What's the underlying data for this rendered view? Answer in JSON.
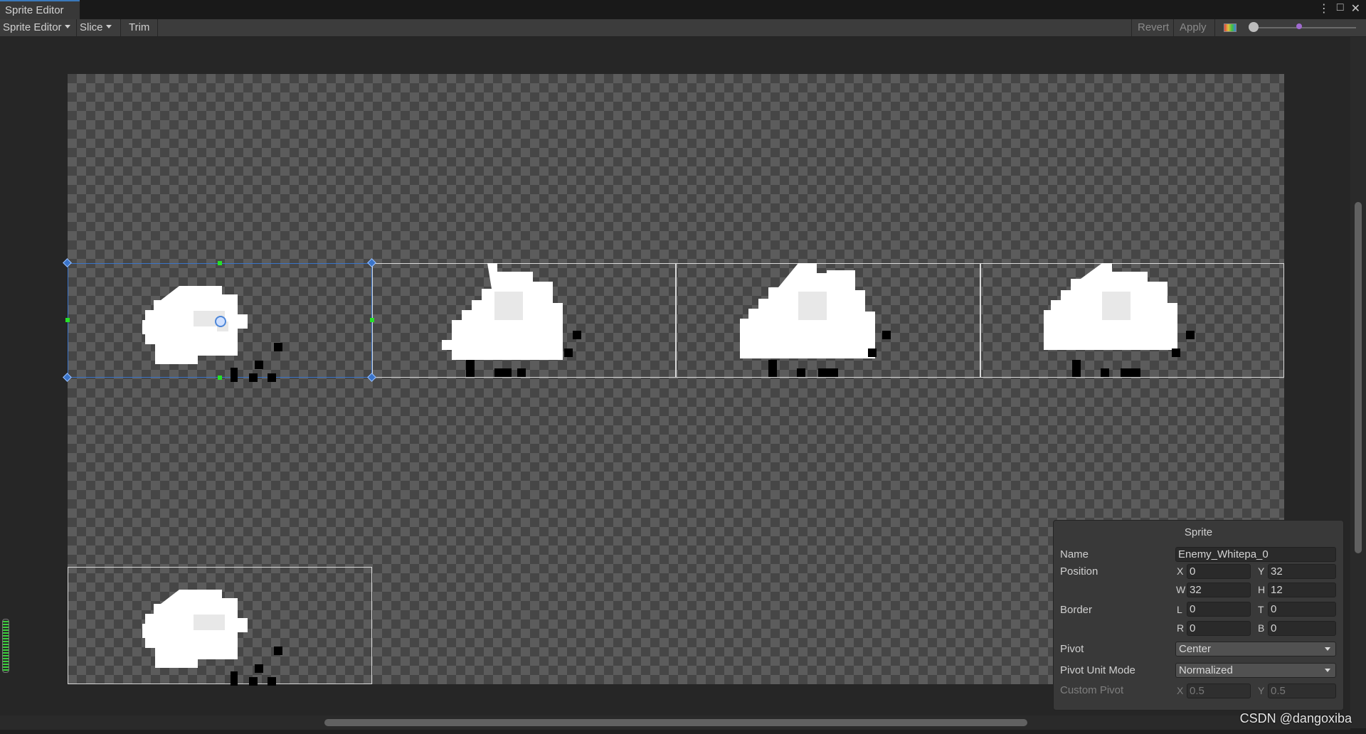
{
  "window": {
    "tab_title": "Sprite Editor",
    "controls": [
      "⋮",
      "□",
      "✕"
    ]
  },
  "toolbar": {
    "mode_label": "Sprite Editor",
    "slice_label": "Slice",
    "trim_label": "Trim",
    "revert_label": "Revert",
    "apply_label": "Apply"
  },
  "sprite_panel": {
    "title": "Sprite",
    "name_label": "Name",
    "name_value": "Enemy_Whitepa_0",
    "position_label": "Position",
    "x_label": "X",
    "x_value": "0",
    "y_label": "Y",
    "y_value": "32",
    "w_label": "W",
    "w_value": "32",
    "h_label": "H",
    "h_value": "12",
    "border_label": "Border",
    "l_label": "L",
    "l_value": "0",
    "t_label": "T",
    "t_value": "0",
    "r_label": "R",
    "r_value": "0",
    "b_label": "B",
    "b_value": "0",
    "pivot_label": "Pivot",
    "pivot_value": "Center",
    "pivot_unit_label": "Pivot Unit Mode",
    "pivot_unit_value": "Normalized",
    "custom_pivot_label": "Custom Pivot",
    "cp_x_label": "X",
    "cp_x_value": "0.5",
    "cp_y_label": "Y",
    "cp_y_value": "0.5"
  },
  "watermark": "CSDN @dangoxiba",
  "colors": {
    "accent": "#3a74c9",
    "handle_green": "#27e027",
    "panel_bg": "#393939"
  }
}
